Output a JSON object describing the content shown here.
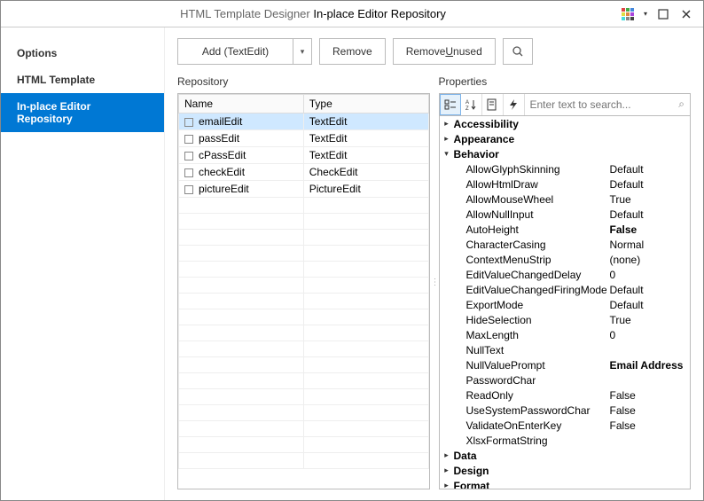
{
  "titlebar": {
    "context": "HTML Template Designer",
    "page": "In-place Editor Repository"
  },
  "sidebar": {
    "items": [
      {
        "label": "Options",
        "active": false
      },
      {
        "label": "HTML Template",
        "active": false
      },
      {
        "label": "In-place Editor Repository",
        "active": true
      }
    ]
  },
  "toolbar": {
    "add_label": "Add (TextEdit)",
    "remove_label": "Remove",
    "remove_unused_label": "Remove Unused"
  },
  "repository": {
    "title": "Repository",
    "columns": [
      "Name",
      "Type"
    ],
    "rows": [
      {
        "name": "emailEdit",
        "type": "TextEdit",
        "selected": true
      },
      {
        "name": "passEdit",
        "type": "TextEdit",
        "selected": false
      },
      {
        "name": "cPassEdit",
        "type": "TextEdit",
        "selected": false
      },
      {
        "name": "checkEdit",
        "type": "CheckEdit",
        "selected": false
      },
      {
        "name": "pictureEdit",
        "type": "PictureEdit",
        "selected": false
      }
    ],
    "empty_rows": 17
  },
  "properties": {
    "title": "Properties",
    "search_placeholder": "Enter text to search...",
    "categories": [
      {
        "name": "Accessibility",
        "expanded": false,
        "props": []
      },
      {
        "name": "Appearance",
        "expanded": false,
        "props": []
      },
      {
        "name": "Behavior",
        "expanded": true,
        "props": [
          {
            "name": "AllowGlyphSkinning",
            "value": "Default",
            "bold": false
          },
          {
            "name": "AllowHtmlDraw",
            "value": "Default",
            "bold": false
          },
          {
            "name": "AllowMouseWheel",
            "value": "True",
            "bold": false
          },
          {
            "name": "AllowNullInput",
            "value": "Default",
            "bold": false
          },
          {
            "name": "AutoHeight",
            "value": "False",
            "bold": true
          },
          {
            "name": "CharacterCasing",
            "value": "Normal",
            "bold": false
          },
          {
            "name": "ContextMenuStrip",
            "value": "(none)",
            "bold": false
          },
          {
            "name": "EditValueChangedDelay",
            "value": "0",
            "bold": false
          },
          {
            "name": "EditValueChangedFiringMode",
            "value": "Default",
            "bold": false
          },
          {
            "name": "ExportMode",
            "value": "Default",
            "bold": false
          },
          {
            "name": "HideSelection",
            "value": "True",
            "bold": false
          },
          {
            "name": "MaxLength",
            "value": "0",
            "bold": false
          },
          {
            "name": "NullText",
            "value": "",
            "bold": false
          },
          {
            "name": "NullValuePrompt",
            "value": "Email Address",
            "bold": true
          },
          {
            "name": "PasswordChar",
            "value": "",
            "bold": false
          },
          {
            "name": "ReadOnly",
            "value": "False",
            "bold": false
          },
          {
            "name": "UseSystemPasswordChar",
            "value": "False",
            "bold": false
          },
          {
            "name": "ValidateOnEnterKey",
            "value": "False",
            "bold": false
          },
          {
            "name": "XlsxFormatString",
            "value": "",
            "bold": false
          }
        ]
      },
      {
        "name": "Data",
        "expanded": false,
        "props": []
      },
      {
        "name": "Design",
        "expanded": false,
        "props": []
      },
      {
        "name": "Format",
        "expanded": false,
        "props": []
      }
    ]
  }
}
